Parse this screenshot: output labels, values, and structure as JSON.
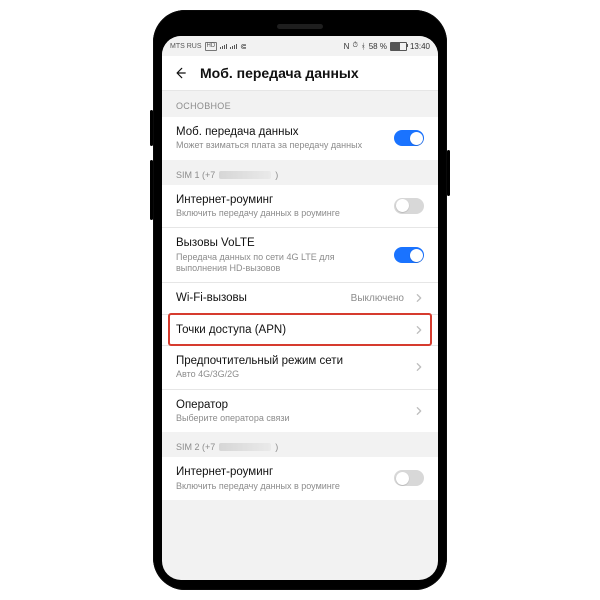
{
  "statusbar": {
    "carrier": "MTS RUS",
    "nfc": "N",
    "alarm": "⏰",
    "bt": "✱",
    "battery_text": "58 %",
    "time": "13:40"
  },
  "header": {
    "title": "Моб. передача данных"
  },
  "sections": {
    "main_label": "ОСНОВНОЕ",
    "mobile_data": {
      "title": "Моб. передача данных",
      "sub": "Может взиматься плата за передачу данных",
      "on": true
    },
    "sim1_label": "SIM 1 (+7",
    "sim1_suffix": ")",
    "roaming1": {
      "title": "Интернет-роуминг",
      "sub": "Включить передачу данных в роуминге",
      "on": false
    },
    "volte": {
      "title": "Вызовы VoLTE",
      "sub": "Передача данных по сети 4G LTE для выполнения HD-вызовов",
      "on": true
    },
    "wifi_calls": {
      "title": "Wi-Fi-вызовы",
      "value": "Выключено"
    },
    "apn": {
      "title": "Точки доступа (APN)"
    },
    "pref_net": {
      "title": "Предпочтительный режим сети",
      "sub": "Авто 4G/3G/2G"
    },
    "operator": {
      "title": "Оператор",
      "sub": "Выберите оператора связи"
    },
    "sim2_label": "SIM 2 (+7",
    "sim2_suffix": ")",
    "roaming2": {
      "title": "Интернет-роуминг",
      "sub": "Включить передачу данных в роуминге",
      "on": false
    }
  }
}
